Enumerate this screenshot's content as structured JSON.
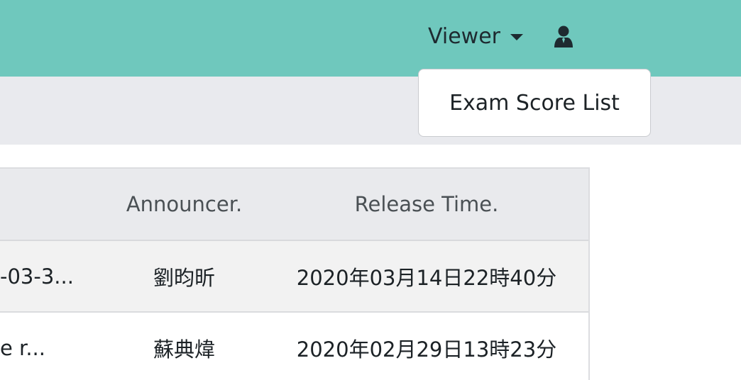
{
  "navbar": {
    "role_dropdown_label": "Viewer",
    "user_icon": "user-icon",
    "background": "#6fc8bd"
  },
  "dropdown": {
    "items": [
      {
        "label": "Exam Score List"
      }
    ]
  },
  "table": {
    "headers": {
      "announcer": "Announcer.",
      "release_time": "Release Time."
    },
    "rows": [
      {
        "title": "-03-3...",
        "announcer": "劉昀昕",
        "release_time": "2020年03月14日22時40分"
      },
      {
        "title": "e r...",
        "announcer": "蘇典煒",
        "release_time": "2020年02月29日13時23分"
      }
    ]
  }
}
